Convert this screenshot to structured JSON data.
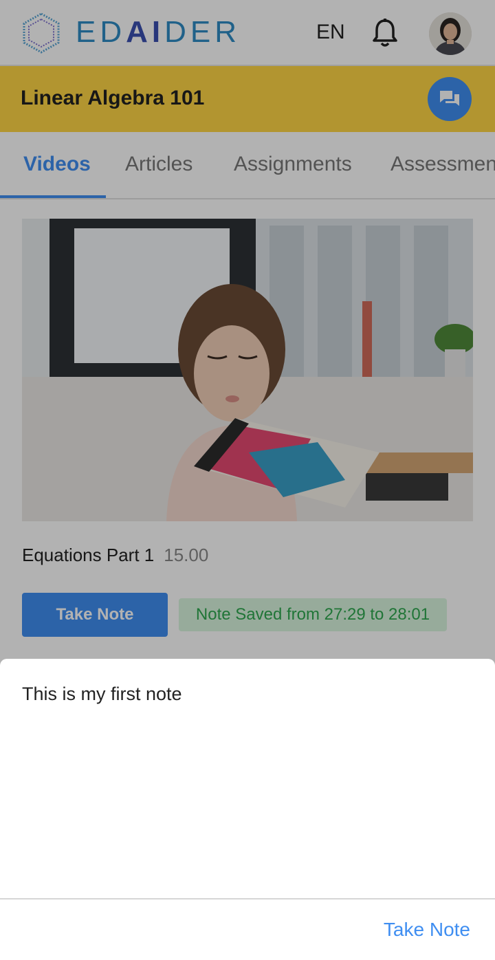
{
  "header": {
    "logo_prefix": "ED",
    "logo_ai": "AI",
    "logo_suffix": "DER",
    "language": "EN"
  },
  "course": {
    "title": "Linear Algebra 101"
  },
  "tabs": [
    {
      "label": "Videos",
      "active": true
    },
    {
      "label": "Articles",
      "active": false
    },
    {
      "label": "Assignments",
      "active": false
    },
    {
      "label": "Assessments",
      "active": false
    }
  ],
  "video": {
    "title": "Equations Part 1",
    "duration": "15.00"
  },
  "actions": {
    "take_note_label": "Take Note",
    "saved_status": "Note Saved from 27:29 to 28:01"
  },
  "note_sheet": {
    "text": "This is my first note",
    "action_label": "Take Note"
  },
  "colors": {
    "accent": "#3f8ef1",
    "course_bar": "#ffd645",
    "success_bg": "#d9f5df",
    "success_text": "#2fa84f"
  },
  "icons": {
    "notifications": "bell-icon",
    "chat": "chat-icon",
    "logo": "hexagon-logo-icon"
  }
}
